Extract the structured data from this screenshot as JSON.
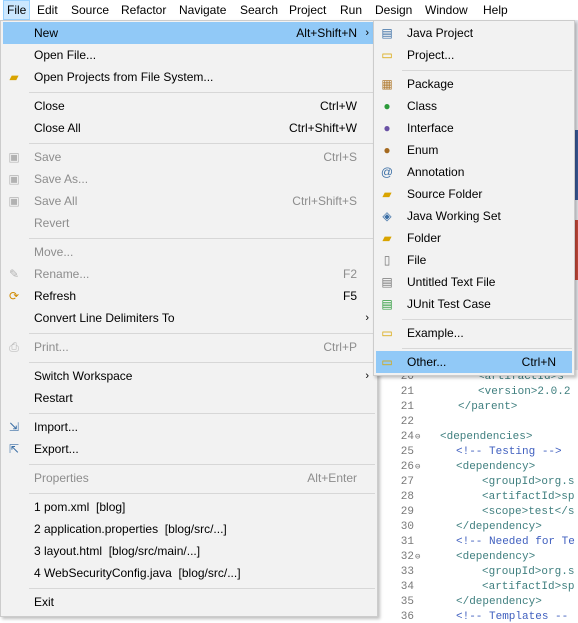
{
  "menubar": [
    "File",
    "Edit",
    "Source",
    "Refactor",
    "Navigate",
    "Search",
    "Project",
    "Run",
    "Design",
    "Window",
    "Help"
  ],
  "file_menu": {
    "new": {
      "label": "New",
      "accel": "Alt+Shift+N"
    },
    "open_file": {
      "label": "Open File..."
    },
    "open_projects": {
      "label": "Open Projects from File System..."
    },
    "close": {
      "label": "Close",
      "accel": "Ctrl+W"
    },
    "close_all": {
      "label": "Close All",
      "accel": "Ctrl+Shift+W"
    },
    "save": {
      "label": "Save",
      "accel": "Ctrl+S"
    },
    "save_as": {
      "label": "Save As..."
    },
    "save_all": {
      "label": "Save All",
      "accel": "Ctrl+Shift+S"
    },
    "revert": {
      "label": "Revert"
    },
    "move": {
      "label": "Move..."
    },
    "rename": {
      "label": "Rename...",
      "accel": "F2"
    },
    "refresh": {
      "label": "Refresh",
      "accel": "F5"
    },
    "convert": {
      "label": "Convert Line Delimiters To"
    },
    "print": {
      "label": "Print...",
      "accel": "Ctrl+P"
    },
    "switch_ws": {
      "label": "Switch Workspace"
    },
    "restart": {
      "label": "Restart"
    },
    "import": {
      "label": "Import..."
    },
    "export": {
      "label": "Export..."
    },
    "properties": {
      "label": "Properties",
      "accel": "Alt+Enter"
    },
    "recent": [
      "1 pom.xml  [blog]",
      "2 application.properties  [blog/src/...]",
      "3 layout.html  [blog/src/main/...]",
      "4 WebSecurityConfig.java  [blog/src/...]"
    ],
    "exit": {
      "label": "Exit"
    }
  },
  "new_menu": {
    "java_project": "Java Project",
    "project": "Project...",
    "package": "Package",
    "class": "Class",
    "interface": "Interface",
    "enum": "Enum",
    "annotation": "Annotation",
    "source_folder": "Source Folder",
    "working_set": "Java Working Set",
    "folder": "Folder",
    "file": "File",
    "untitled": "Untitled Text File",
    "junit": "JUnit Test Case",
    "example": "Example...",
    "other": {
      "label": "Other...",
      "accel": "Ctrl+N"
    }
  },
  "editor": {
    "lines": [
      {
        "n": "21",
        "code": "</parent>"
      },
      {
        "n": "22",
        "code": ""
      },
      {
        "n": "24",
        "code": "<dependencies>"
      },
      {
        "n": "25",
        "code": "<!-- Testing -->"
      },
      {
        "n": "26",
        "code": "<dependency>"
      },
      {
        "n": "27",
        "code": "<groupId>org.s"
      },
      {
        "n": "28",
        "code": "<artifactId>sp"
      },
      {
        "n": "29",
        "code": "<scope>test</s"
      },
      {
        "n": "30",
        "code": "</dependency>"
      },
      {
        "n": "31",
        "code": "<!-- Needed for Te"
      },
      {
        "n": "32",
        "code": "<dependency>"
      },
      {
        "n": "33",
        "code": "<groupId>org.s"
      },
      {
        "n": "34",
        "code": "<artifactId>sp"
      },
      {
        "n": "35",
        "code": "</dependency>"
      },
      {
        "n": "36",
        "code": "<!-- Templates --"
      }
    ],
    "top_lines": [
      {
        "n": "20",
        "code": "<artifactId>s"
      },
      {
        "n": "21",
        "code": "<version>2.0.2"
      }
    ]
  },
  "colors": {
    "highlight": "#91c9f7",
    "menu_bg": "#f2f2f2",
    "disabled": "#8d8d8d"
  }
}
